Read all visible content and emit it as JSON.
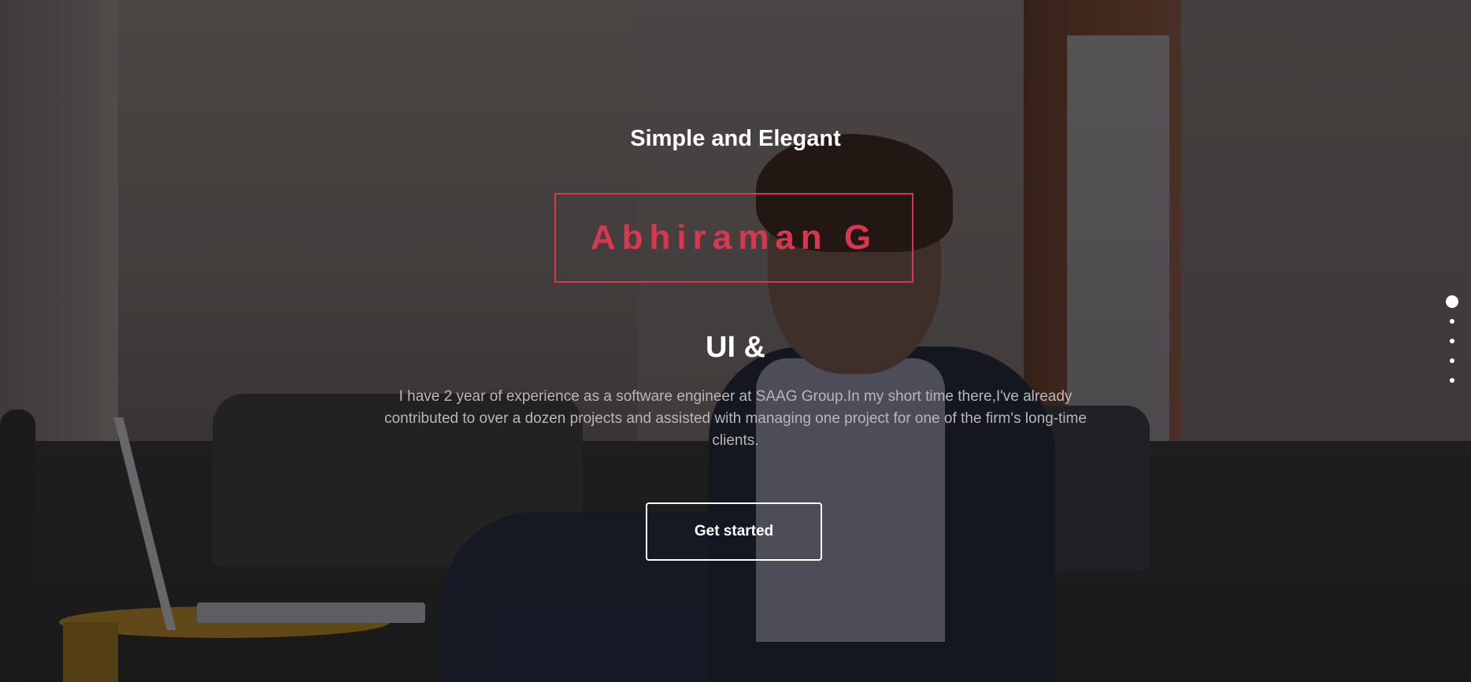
{
  "hero": {
    "tagline": "Simple and Elegant",
    "name": "Abhiraman G",
    "role": "UI &",
    "bio": "I have 2 year of experience as a software engineer at SAAG Group.In my short time there,I've already contributed to over a dozen projects and assisted with managing one project for one of the firm's long-time clients.",
    "cta_label": "Get started"
  },
  "pagination": {
    "active_index": 0,
    "count": 5
  },
  "colors": {
    "accent": "#d7384f",
    "text": "#ffffff",
    "muted_text": "#b9b6b7"
  }
}
